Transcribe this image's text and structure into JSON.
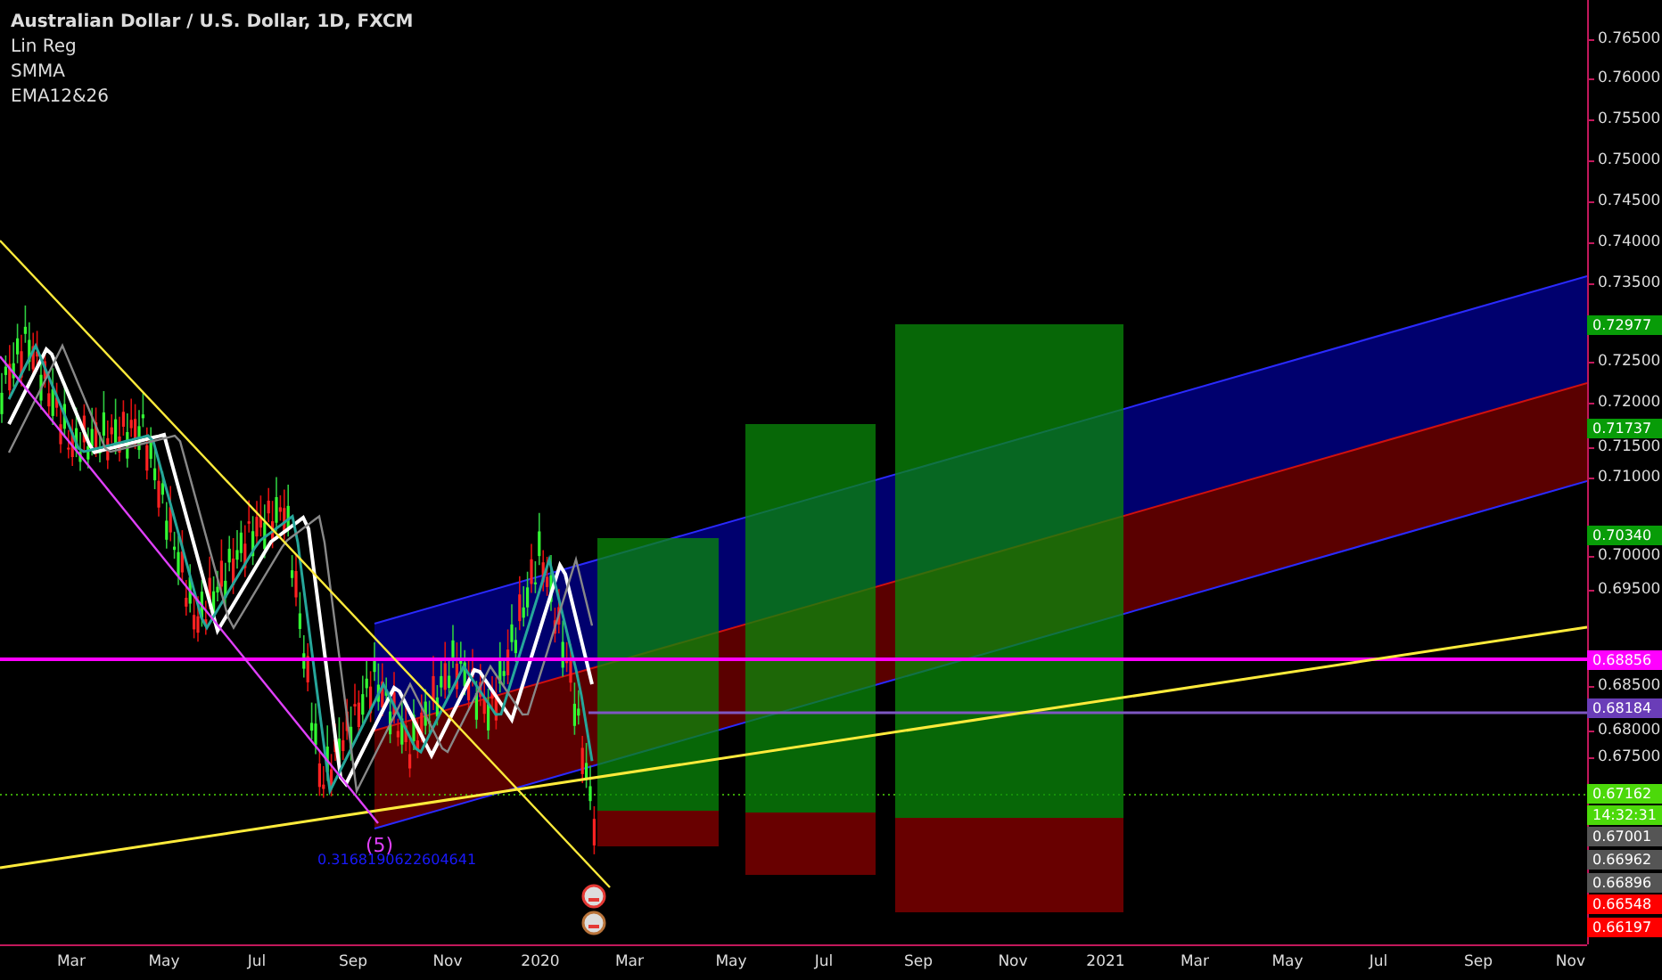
{
  "legend": [
    "Australian Dollar / U.S. Dollar, 1D, FXCM",
    "Lin Reg",
    "SMMA",
    "EMA12&26"
  ],
  "price_ticks": [
    "0.76500",
    "0.76000",
    "0.75500",
    "0.75000",
    "0.74500",
    "0.74000",
    "0.73500",
    "0.72500",
    "0.72000",
    "0.71500",
    "0.71000",
    "0.70000",
    "0.69500",
    "0.68500",
    "0.68000",
    "0.67500"
  ],
  "price_badges": [
    {
      "label": "0.72977",
      "color": "#089c08"
    },
    {
      "label": "0.71737",
      "color": "#089c08"
    },
    {
      "label": "0.70340",
      "color": "#089c08"
    },
    {
      "label": "0.68856",
      "color": "#ff00ff"
    },
    {
      "label": "0.68184",
      "color": "#6a3db8"
    },
    {
      "label": "0.67162",
      "color": "#4cd90a"
    },
    {
      "label": "14:32:31",
      "color": "#4cd90a"
    },
    {
      "label": "0.67001",
      "color": "#555555"
    },
    {
      "label": "0.66962",
      "color": "#555555"
    },
    {
      "label": "0.66896",
      "color": "#555555"
    },
    {
      "label": "0.66548",
      "color": "#ff0000"
    },
    {
      "label": "0.66197",
      "color": "#ff0000"
    }
  ],
  "time_axis": [
    "Mar",
    "May",
    "Jul",
    "Sep",
    "Nov",
    "2020",
    "Mar",
    "May",
    "Jul",
    "Sep",
    "Nov",
    "2021",
    "Mar",
    "May",
    "Jul",
    "Sep",
    "Nov"
  ],
  "annotations": {
    "wave_label": "(5)",
    "value_label": "0.3168190622604641"
  }
}
